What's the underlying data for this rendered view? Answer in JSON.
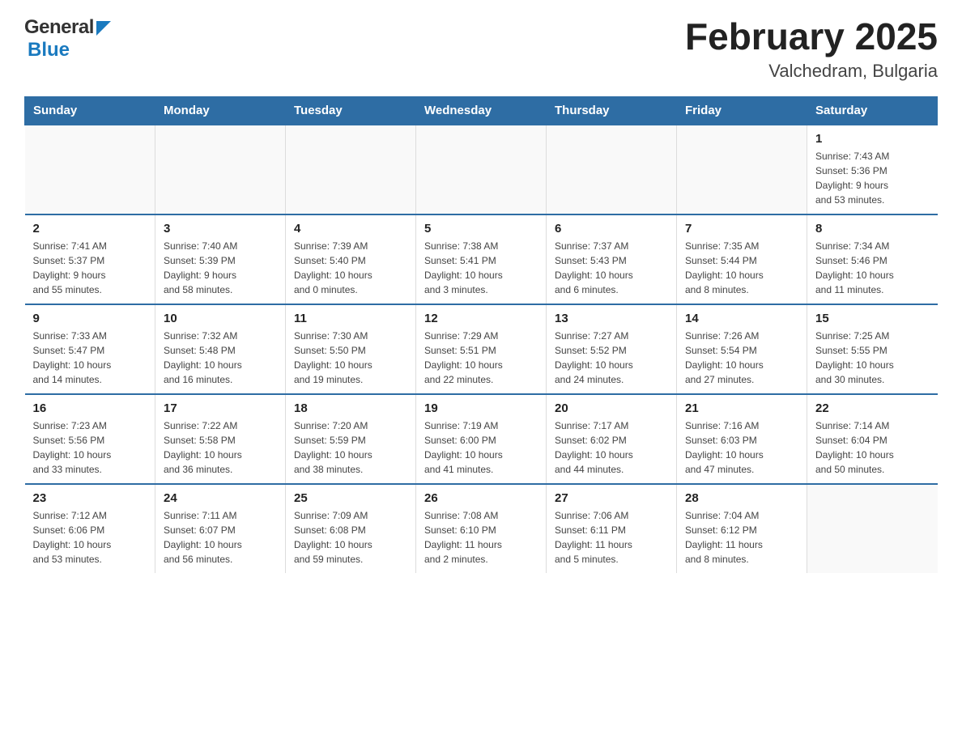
{
  "header": {
    "logo": {
      "text1": "General",
      "text2": "Blue"
    },
    "title": "February 2025",
    "subtitle": "Valchedram, Bulgaria"
  },
  "weekdays": [
    "Sunday",
    "Monday",
    "Tuesday",
    "Wednesday",
    "Thursday",
    "Friday",
    "Saturday"
  ],
  "weeks": [
    {
      "days": [
        {
          "number": "",
          "info": ""
        },
        {
          "number": "",
          "info": ""
        },
        {
          "number": "",
          "info": ""
        },
        {
          "number": "",
          "info": ""
        },
        {
          "number": "",
          "info": ""
        },
        {
          "number": "",
          "info": ""
        },
        {
          "number": "1",
          "info": "Sunrise: 7:43 AM\nSunset: 5:36 PM\nDaylight: 9 hours\nand 53 minutes."
        }
      ]
    },
    {
      "days": [
        {
          "number": "2",
          "info": "Sunrise: 7:41 AM\nSunset: 5:37 PM\nDaylight: 9 hours\nand 55 minutes."
        },
        {
          "number": "3",
          "info": "Sunrise: 7:40 AM\nSunset: 5:39 PM\nDaylight: 9 hours\nand 58 minutes."
        },
        {
          "number": "4",
          "info": "Sunrise: 7:39 AM\nSunset: 5:40 PM\nDaylight: 10 hours\nand 0 minutes."
        },
        {
          "number": "5",
          "info": "Sunrise: 7:38 AM\nSunset: 5:41 PM\nDaylight: 10 hours\nand 3 minutes."
        },
        {
          "number": "6",
          "info": "Sunrise: 7:37 AM\nSunset: 5:43 PM\nDaylight: 10 hours\nand 6 minutes."
        },
        {
          "number": "7",
          "info": "Sunrise: 7:35 AM\nSunset: 5:44 PM\nDaylight: 10 hours\nand 8 minutes."
        },
        {
          "number": "8",
          "info": "Sunrise: 7:34 AM\nSunset: 5:46 PM\nDaylight: 10 hours\nand 11 minutes."
        }
      ]
    },
    {
      "days": [
        {
          "number": "9",
          "info": "Sunrise: 7:33 AM\nSunset: 5:47 PM\nDaylight: 10 hours\nand 14 minutes."
        },
        {
          "number": "10",
          "info": "Sunrise: 7:32 AM\nSunset: 5:48 PM\nDaylight: 10 hours\nand 16 minutes."
        },
        {
          "number": "11",
          "info": "Sunrise: 7:30 AM\nSunset: 5:50 PM\nDaylight: 10 hours\nand 19 minutes."
        },
        {
          "number": "12",
          "info": "Sunrise: 7:29 AM\nSunset: 5:51 PM\nDaylight: 10 hours\nand 22 minutes."
        },
        {
          "number": "13",
          "info": "Sunrise: 7:27 AM\nSunset: 5:52 PM\nDaylight: 10 hours\nand 24 minutes."
        },
        {
          "number": "14",
          "info": "Sunrise: 7:26 AM\nSunset: 5:54 PM\nDaylight: 10 hours\nand 27 minutes."
        },
        {
          "number": "15",
          "info": "Sunrise: 7:25 AM\nSunset: 5:55 PM\nDaylight: 10 hours\nand 30 minutes."
        }
      ]
    },
    {
      "days": [
        {
          "number": "16",
          "info": "Sunrise: 7:23 AM\nSunset: 5:56 PM\nDaylight: 10 hours\nand 33 minutes."
        },
        {
          "number": "17",
          "info": "Sunrise: 7:22 AM\nSunset: 5:58 PM\nDaylight: 10 hours\nand 36 minutes."
        },
        {
          "number": "18",
          "info": "Sunrise: 7:20 AM\nSunset: 5:59 PM\nDaylight: 10 hours\nand 38 minutes."
        },
        {
          "number": "19",
          "info": "Sunrise: 7:19 AM\nSunset: 6:00 PM\nDaylight: 10 hours\nand 41 minutes."
        },
        {
          "number": "20",
          "info": "Sunrise: 7:17 AM\nSunset: 6:02 PM\nDaylight: 10 hours\nand 44 minutes."
        },
        {
          "number": "21",
          "info": "Sunrise: 7:16 AM\nSunset: 6:03 PM\nDaylight: 10 hours\nand 47 minutes."
        },
        {
          "number": "22",
          "info": "Sunrise: 7:14 AM\nSunset: 6:04 PM\nDaylight: 10 hours\nand 50 minutes."
        }
      ]
    },
    {
      "days": [
        {
          "number": "23",
          "info": "Sunrise: 7:12 AM\nSunset: 6:06 PM\nDaylight: 10 hours\nand 53 minutes."
        },
        {
          "number": "24",
          "info": "Sunrise: 7:11 AM\nSunset: 6:07 PM\nDaylight: 10 hours\nand 56 minutes."
        },
        {
          "number": "25",
          "info": "Sunrise: 7:09 AM\nSunset: 6:08 PM\nDaylight: 10 hours\nand 59 minutes."
        },
        {
          "number": "26",
          "info": "Sunrise: 7:08 AM\nSunset: 6:10 PM\nDaylight: 11 hours\nand 2 minutes."
        },
        {
          "number": "27",
          "info": "Sunrise: 7:06 AM\nSunset: 6:11 PM\nDaylight: 11 hours\nand 5 minutes."
        },
        {
          "number": "28",
          "info": "Sunrise: 7:04 AM\nSunset: 6:12 PM\nDaylight: 11 hours\nand 8 minutes."
        },
        {
          "number": "",
          "info": ""
        }
      ]
    }
  ]
}
